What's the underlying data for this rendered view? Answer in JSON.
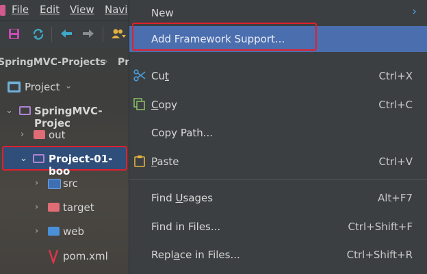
{
  "menubar": {
    "items": [
      "File",
      "Edit",
      "View",
      "Navi"
    ]
  },
  "breadcrumbs": [
    "SpringMVC-Projects",
    "Pr"
  ],
  "project_view": {
    "label": "Project"
  },
  "tree": [
    {
      "label": "SpringMVC-Projec",
      "type": "module-folder",
      "expanded": true
    },
    {
      "label": "out",
      "type": "excluded-folder"
    },
    {
      "label": "Project-01-boo",
      "type": "module-folder",
      "expanded": true,
      "selected": true
    },
    {
      "label": "src",
      "type": "source-folder"
    },
    {
      "label": "target",
      "type": "excluded-folder"
    },
    {
      "label": "web",
      "type": "web-folder"
    },
    {
      "label": "pom.xml",
      "type": "maven-file"
    }
  ],
  "context_menu": {
    "new": {
      "label": "New"
    },
    "add_framework": {
      "label": "Add Framework Support..."
    },
    "cut": {
      "label_pre": "Cu",
      "label_u": "t",
      "label_post": "",
      "shortcut": "Ctrl+X"
    },
    "copy": {
      "label_pre": "",
      "label_u": "C",
      "label_post": "opy",
      "shortcut": "Ctrl+C"
    },
    "copy_path": {
      "label": "Copy Path..."
    },
    "paste": {
      "label_pre": "",
      "label_u": "P",
      "label_post": "aste",
      "shortcut": "Ctrl+V"
    },
    "find_usages": {
      "label_pre": "Find ",
      "label_u": "U",
      "label_post": "sages",
      "shortcut": "Alt+F7"
    },
    "find_in_files": {
      "label": "Find in Files...",
      "shortcut": "Ctrl+Shift+F"
    },
    "replace_in_files": {
      "label_pre": "Repl",
      "label_u": "a",
      "label_post": "ce in Files...",
      "shortcut": "Ctrl+Shift+R"
    }
  },
  "colors": {
    "highlight": "#4b6eaf",
    "annotation_red": "#e0202b",
    "menu_bg": "#3c3f41"
  }
}
